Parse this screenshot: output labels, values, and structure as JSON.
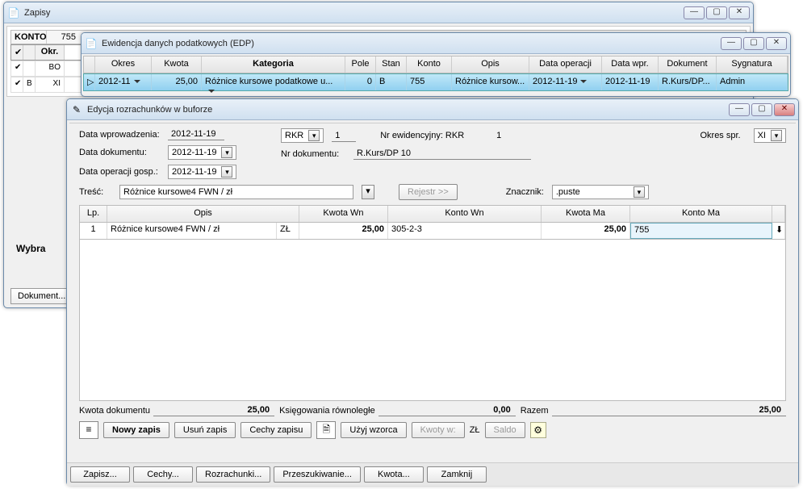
{
  "zapisy": {
    "title": "Zapisy",
    "header_konto": "KONTO",
    "header_konto_val": "755",
    "th_okr": "Okr.",
    "rows": [
      {
        "b": "",
        "okr": "BO"
      },
      {
        "b": "B",
        "okr": "XI"
      }
    ],
    "wybra": "Wybra",
    "dokument_btn": "Dokument..."
  },
  "edp": {
    "title": "Ewidencja danych podatkowych (EDP)",
    "cols": {
      "okres": "Okres",
      "kwota": "Kwota",
      "kategoria": "Kategoria",
      "pole": "Pole",
      "stan": "Stan",
      "konto": "Konto",
      "opis": "Opis",
      "data_op": "Data operacji",
      "data_wpr": "Data wpr.",
      "dokument": "Dokument",
      "sygnatura": "Sygnatura"
    },
    "row": {
      "okres": "2012-11",
      "kwota": "25,00",
      "kategoria": "Różnice kursowe podatkowe u...",
      "pole": "0",
      "stan": "B",
      "konto": "755",
      "opis": "Różnice kursow...",
      "data_op": "2012-11-19",
      "data_wpr": "2012-11-19",
      "dokument": "R.Kurs/DP...",
      "sygnatura": "Admin"
    }
  },
  "erb": {
    "title": "Edycja rozrachunków w buforze",
    "labels": {
      "data_wpr": "Data wprowadzenia:",
      "data_dok": "Data dokumentu:",
      "data_op": "Data operacji gosp.:",
      "tresc": "Treść:",
      "rkr": "RKR",
      "rkr_num": "1",
      "nr_ew": "Nr ewidencyjny: RKR",
      "nr_ew_num": "1",
      "nr_dok": "Nr dokumentu:",
      "nr_dok_val": "R.Kurs/DP 10",
      "okres_spr": "Okres spr.",
      "okres_spr_val": "XI",
      "rejestr": "Rejestr >>",
      "znacznik": "Znacznik:",
      "znacznik_val": ".puste"
    },
    "vals": {
      "data_wpr": "2012-11-19",
      "data_dok": "2012-11-19",
      "data_op": "2012-11-19",
      "tresc": "Różnice kursowe4 FWN / zł"
    },
    "grid": {
      "cols": {
        "lp": "Lp.",
        "opis": "Opis",
        "kwota_wn": "Kwota Wn",
        "konto_wn": "Konto Wn",
        "kwota_ma": "Kwota Ma",
        "konto_ma": "Konto Ma"
      },
      "row": {
        "lp": "1",
        "opis": "Różnice kursowe4 FWN / zł",
        "curr": "ZŁ",
        "kwota_wn": "25,00",
        "konto_wn": "305-2-3",
        "kwota_ma": "25,00",
        "konto_ma": "755"
      }
    },
    "footer": {
      "kwota_dok": "Kwota dokumentu",
      "kwota_dok_val": "25,00",
      "ksieg": "Księgowania równoległe",
      "ksieg_val": "0,00",
      "razem": "Razem",
      "razem_val": "25,00"
    },
    "toolbar": {
      "nowy": "Nowy zapis",
      "usun": "Usuń zapis",
      "cechy": "Cechy zapisu",
      "uzyj": "Użyj wzorca",
      "kwoty_w": "Kwoty w:",
      "zl": "ZŁ",
      "saldo": "Saldo"
    },
    "bottom": {
      "zapisz": "Zapisz...",
      "cechy": "Cechy...",
      "rozr": "Rozrachunki...",
      "przesz": "Przeszukiwanie...",
      "kwota": "Kwota...",
      "zamknij": "Zamknij"
    }
  }
}
